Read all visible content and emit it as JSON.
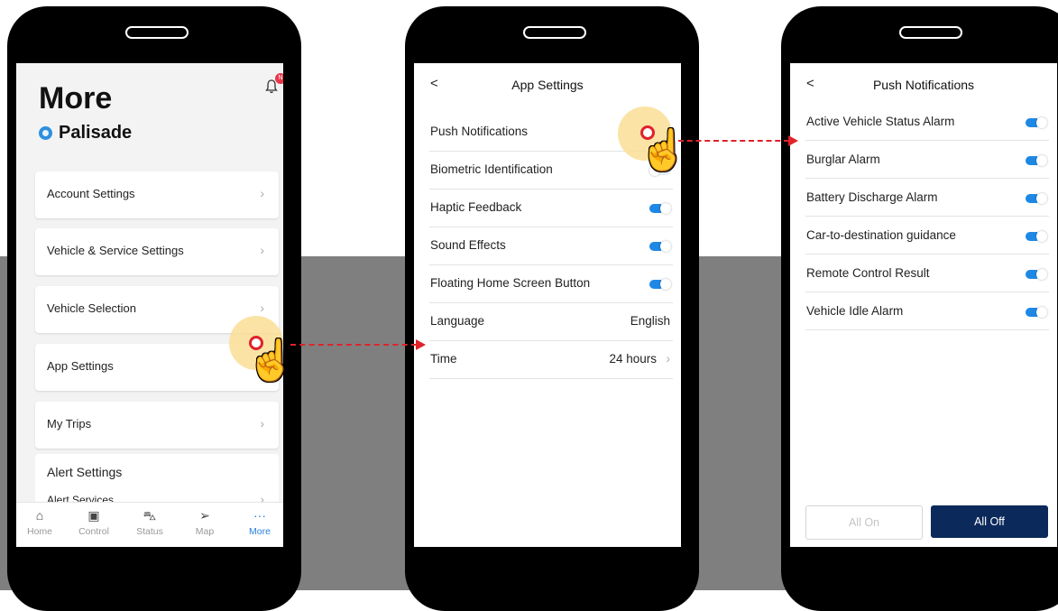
{
  "phone1": {
    "title": "More",
    "vehicle": "Palisade",
    "notification_badge": "N",
    "menu": [
      {
        "label": "Account Settings"
      },
      {
        "label": "Vehicle & Service Settings"
      },
      {
        "label": "Vehicle Selection"
      },
      {
        "label": "App Settings"
      },
      {
        "label": "My Trips"
      }
    ],
    "alert_settings": {
      "title": "Alert Settings",
      "item": "Alert Services"
    },
    "tabs": [
      {
        "label": "Home",
        "icon": "home-icon"
      },
      {
        "label": "Control",
        "icon": "control-icon"
      },
      {
        "label": "Status",
        "icon": "car-icon"
      },
      {
        "label": "Map",
        "icon": "navigation-icon"
      },
      {
        "label": "More",
        "icon": "more-icon",
        "active": true
      }
    ]
  },
  "phone2": {
    "back": "<",
    "title": "App Settings",
    "rows": [
      {
        "label": "Push Notifications",
        "type": "chevron"
      },
      {
        "label": "Biometric Identification",
        "type": "toggle",
        "on": false
      },
      {
        "label": "Haptic Feedback",
        "type": "toggle",
        "on": true
      },
      {
        "label": "Sound Effects",
        "type": "toggle",
        "on": true
      },
      {
        "label": "Floating Home Screen Button",
        "type": "toggle",
        "on": true
      },
      {
        "label": "Language",
        "type": "value",
        "value": "English"
      },
      {
        "label": "Time",
        "type": "value",
        "value": "24 hours"
      }
    ]
  },
  "phone3": {
    "back": "<",
    "title": "Push Notifications",
    "rows": [
      {
        "label": "Active Vehicle Status Alarm",
        "on": true
      },
      {
        "label": "Burglar Alarm",
        "on": true
      },
      {
        "label": "Battery Discharge Alarm",
        "on": true
      },
      {
        "label": "Car-to-destination guidance",
        "on": true
      },
      {
        "label": "Remote Control Result",
        "on": true
      },
      {
        "label": "Vehicle Idle Alarm",
        "on": true
      }
    ],
    "all_on": "All On",
    "all_off": "All Off"
  },
  "colors": {
    "accent": "#1e88e5",
    "navy_button": "#0b2a5b",
    "tap_ring": "#e0222a",
    "tap_highlight": "#fadE96",
    "background_band": "#7f7f7f"
  }
}
